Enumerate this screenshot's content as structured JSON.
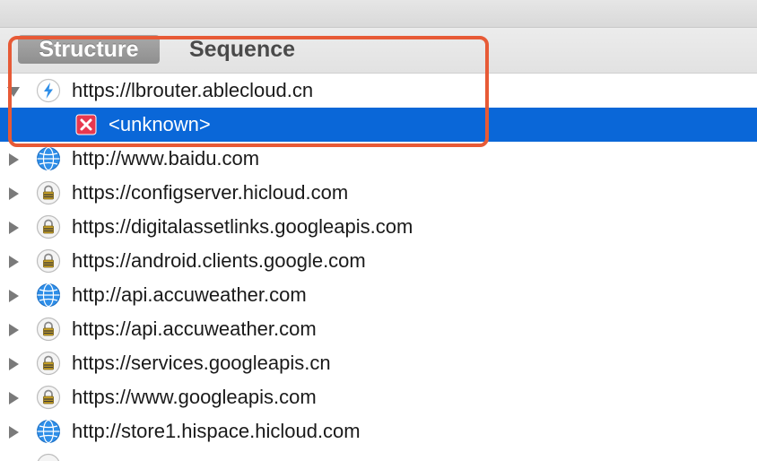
{
  "tabs": [
    {
      "label": "Structure",
      "selected": true
    },
    {
      "label": "Sequence",
      "selected": false
    }
  ],
  "tree": {
    "host_root": {
      "label": "https://lbrouter.ablecloud.cn",
      "icon": "lightning-icon",
      "expanded": true
    },
    "child": {
      "label": "<unknown>",
      "icon": "error-x-icon",
      "selected": true
    },
    "hosts": [
      {
        "label": "http://www.baidu.com",
        "icon": "globe-icon"
      },
      {
        "label": "https://configserver.hicloud.com",
        "icon": "lock-icon"
      },
      {
        "label": "https://digitalassetlinks.googleapis.com",
        "icon": "lock-icon"
      },
      {
        "label": "https://android.clients.google.com",
        "icon": "lock-icon"
      },
      {
        "label": "http://api.accuweather.com",
        "icon": "globe-icon"
      },
      {
        "label": "https://api.accuweather.com",
        "icon": "lock-icon"
      },
      {
        "label": "https://services.googleapis.cn",
        "icon": "lock-icon"
      },
      {
        "label": "https://www.googleapis.com",
        "icon": "lock-icon"
      },
      {
        "label": "http://store1.hispace.hicloud.com",
        "icon": "globe-icon"
      }
    ]
  },
  "colors": {
    "selection": "#0a67d8",
    "annotation": "#e75a36",
    "error": "#e8384f",
    "globe": "#2e8ee8"
  }
}
